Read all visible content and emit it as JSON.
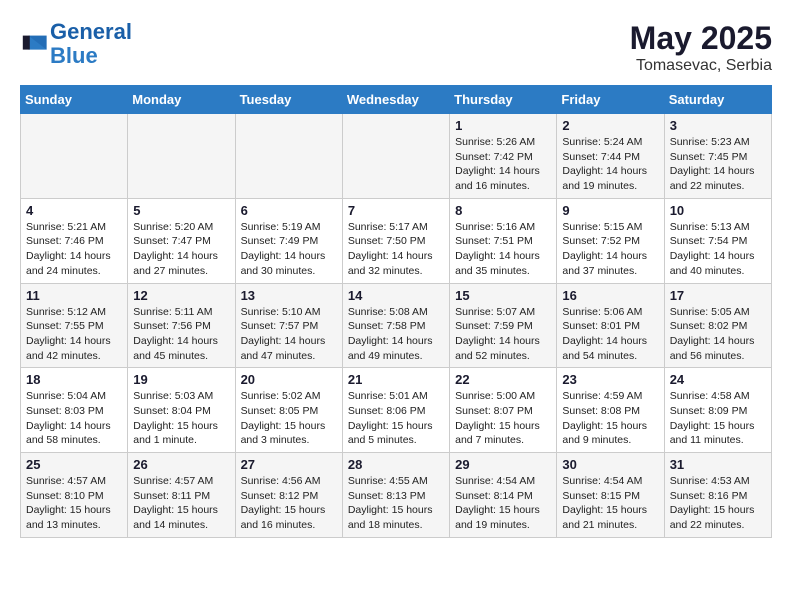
{
  "header": {
    "logo_line1": "General",
    "logo_line2": "Blue",
    "month": "May 2025",
    "location": "Tomasevac, Serbia"
  },
  "days_of_week": [
    "Sunday",
    "Monday",
    "Tuesday",
    "Wednesday",
    "Thursday",
    "Friday",
    "Saturday"
  ],
  "weeks": [
    [
      {
        "day": "",
        "info": ""
      },
      {
        "day": "",
        "info": ""
      },
      {
        "day": "",
        "info": ""
      },
      {
        "day": "",
        "info": ""
      },
      {
        "day": "1",
        "info": "Sunrise: 5:26 AM\nSunset: 7:42 PM\nDaylight: 14 hours\nand 16 minutes."
      },
      {
        "day": "2",
        "info": "Sunrise: 5:24 AM\nSunset: 7:44 PM\nDaylight: 14 hours\nand 19 minutes."
      },
      {
        "day": "3",
        "info": "Sunrise: 5:23 AM\nSunset: 7:45 PM\nDaylight: 14 hours\nand 22 minutes."
      }
    ],
    [
      {
        "day": "4",
        "info": "Sunrise: 5:21 AM\nSunset: 7:46 PM\nDaylight: 14 hours\nand 24 minutes."
      },
      {
        "day": "5",
        "info": "Sunrise: 5:20 AM\nSunset: 7:47 PM\nDaylight: 14 hours\nand 27 minutes."
      },
      {
        "day": "6",
        "info": "Sunrise: 5:19 AM\nSunset: 7:49 PM\nDaylight: 14 hours\nand 30 minutes."
      },
      {
        "day": "7",
        "info": "Sunrise: 5:17 AM\nSunset: 7:50 PM\nDaylight: 14 hours\nand 32 minutes."
      },
      {
        "day": "8",
        "info": "Sunrise: 5:16 AM\nSunset: 7:51 PM\nDaylight: 14 hours\nand 35 minutes."
      },
      {
        "day": "9",
        "info": "Sunrise: 5:15 AM\nSunset: 7:52 PM\nDaylight: 14 hours\nand 37 minutes."
      },
      {
        "day": "10",
        "info": "Sunrise: 5:13 AM\nSunset: 7:54 PM\nDaylight: 14 hours\nand 40 minutes."
      }
    ],
    [
      {
        "day": "11",
        "info": "Sunrise: 5:12 AM\nSunset: 7:55 PM\nDaylight: 14 hours\nand 42 minutes."
      },
      {
        "day": "12",
        "info": "Sunrise: 5:11 AM\nSunset: 7:56 PM\nDaylight: 14 hours\nand 45 minutes."
      },
      {
        "day": "13",
        "info": "Sunrise: 5:10 AM\nSunset: 7:57 PM\nDaylight: 14 hours\nand 47 minutes."
      },
      {
        "day": "14",
        "info": "Sunrise: 5:08 AM\nSunset: 7:58 PM\nDaylight: 14 hours\nand 49 minutes."
      },
      {
        "day": "15",
        "info": "Sunrise: 5:07 AM\nSunset: 7:59 PM\nDaylight: 14 hours\nand 52 minutes."
      },
      {
        "day": "16",
        "info": "Sunrise: 5:06 AM\nSunset: 8:01 PM\nDaylight: 14 hours\nand 54 minutes."
      },
      {
        "day": "17",
        "info": "Sunrise: 5:05 AM\nSunset: 8:02 PM\nDaylight: 14 hours\nand 56 minutes."
      }
    ],
    [
      {
        "day": "18",
        "info": "Sunrise: 5:04 AM\nSunset: 8:03 PM\nDaylight: 14 hours\nand 58 minutes."
      },
      {
        "day": "19",
        "info": "Sunrise: 5:03 AM\nSunset: 8:04 PM\nDaylight: 15 hours\nand 1 minute."
      },
      {
        "day": "20",
        "info": "Sunrise: 5:02 AM\nSunset: 8:05 PM\nDaylight: 15 hours\nand 3 minutes."
      },
      {
        "day": "21",
        "info": "Sunrise: 5:01 AM\nSunset: 8:06 PM\nDaylight: 15 hours\nand 5 minutes."
      },
      {
        "day": "22",
        "info": "Sunrise: 5:00 AM\nSunset: 8:07 PM\nDaylight: 15 hours\nand 7 minutes."
      },
      {
        "day": "23",
        "info": "Sunrise: 4:59 AM\nSunset: 8:08 PM\nDaylight: 15 hours\nand 9 minutes."
      },
      {
        "day": "24",
        "info": "Sunrise: 4:58 AM\nSunset: 8:09 PM\nDaylight: 15 hours\nand 11 minutes."
      }
    ],
    [
      {
        "day": "25",
        "info": "Sunrise: 4:57 AM\nSunset: 8:10 PM\nDaylight: 15 hours\nand 13 minutes."
      },
      {
        "day": "26",
        "info": "Sunrise: 4:57 AM\nSunset: 8:11 PM\nDaylight: 15 hours\nand 14 minutes."
      },
      {
        "day": "27",
        "info": "Sunrise: 4:56 AM\nSunset: 8:12 PM\nDaylight: 15 hours\nand 16 minutes."
      },
      {
        "day": "28",
        "info": "Sunrise: 4:55 AM\nSunset: 8:13 PM\nDaylight: 15 hours\nand 18 minutes."
      },
      {
        "day": "29",
        "info": "Sunrise: 4:54 AM\nSunset: 8:14 PM\nDaylight: 15 hours\nand 19 minutes."
      },
      {
        "day": "30",
        "info": "Sunrise: 4:54 AM\nSunset: 8:15 PM\nDaylight: 15 hours\nand 21 minutes."
      },
      {
        "day": "31",
        "info": "Sunrise: 4:53 AM\nSunset: 8:16 PM\nDaylight: 15 hours\nand 22 minutes."
      }
    ]
  ]
}
